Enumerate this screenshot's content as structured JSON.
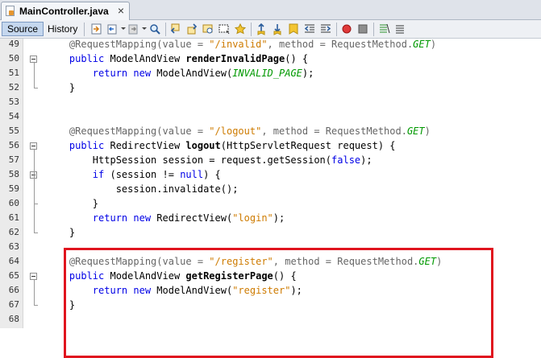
{
  "tab": {
    "title": "MainController.java",
    "close": "×"
  },
  "toolbar": {
    "source_label": "Source",
    "history_label": "History",
    "icons": [
      "last-edit-icon",
      "back-icon",
      "forward-icon",
      "find-icon",
      "find-previous-icon",
      "find-next-icon",
      "find-selection-icon",
      "toggle-highlight-icon",
      "toggle-rectangular-icon",
      "previous-bookmark-icon",
      "next-bookmark-icon",
      "toggle-bookmark-icon",
      "shift-left-icon",
      "shift-right-icon",
      "start-macro-icon",
      "stop-macro-icon",
      "comment-icon",
      "uncomment-icon"
    ]
  },
  "editor": {
    "lines": [
      {
        "n": "49",
        "fold": "",
        "t": [
          [
            "an",
            "    @RequestMapping(value = "
          ],
          [
            "str",
            "\"/invalid\""
          ],
          [
            "an",
            ", method = RequestMethod."
          ],
          [
            "cst",
            "GET"
          ],
          [
            "an",
            ")"
          ]
        ]
      },
      {
        "n": "50",
        "fold": "start",
        "t": [
          [
            "kw",
            "    public "
          ],
          [
            "",
            "ModelAndView "
          ],
          [
            "bold",
            "renderInvalidPage"
          ],
          [
            "",
            "() {"
          ]
        ]
      },
      {
        "n": "51",
        "fold": "",
        "t": [
          [
            "kw",
            "        return new "
          ],
          [
            "",
            "ModelAndView("
          ],
          [
            "cst",
            "INVALID_PAGE"
          ],
          [
            "",
            ");"
          ]
        ]
      },
      {
        "n": "52",
        "fold": "end",
        "t": [
          [
            "",
            "    }"
          ]
        ]
      },
      {
        "n": "53",
        "fold": "",
        "t": []
      },
      {
        "n": "54",
        "fold": "",
        "t": []
      },
      {
        "n": "55",
        "fold": "",
        "t": [
          [
            "an",
            "    @RequestMapping(value = "
          ],
          [
            "str",
            "\"/logout\""
          ],
          [
            "an",
            ", method = RequestMethod."
          ],
          [
            "cst",
            "GET"
          ],
          [
            "an",
            ")"
          ]
        ]
      },
      {
        "n": "56",
        "fold": "start",
        "t": [
          [
            "kw",
            "    public "
          ],
          [
            "",
            "RedirectView "
          ],
          [
            "bold",
            "logout"
          ],
          [
            "",
            "(HttpServletRequest request) {"
          ]
        ]
      },
      {
        "n": "57",
        "fold": "",
        "t": [
          [
            "",
            "        HttpSession session = request.getSession("
          ],
          [
            "kw",
            "false"
          ],
          [
            "",
            ");"
          ]
        ]
      },
      {
        "n": "58",
        "fold": "start",
        "t": [
          [
            "kw",
            "        if "
          ],
          [
            "",
            "(session != "
          ],
          [
            "kw",
            "null"
          ],
          [
            "",
            ") {"
          ]
        ]
      },
      {
        "n": "59",
        "fold": "",
        "t": [
          [
            "",
            "            session.invalidate();"
          ]
        ]
      },
      {
        "n": "60",
        "fold": "end",
        "t": [
          [
            "",
            "        }"
          ]
        ]
      },
      {
        "n": "61",
        "fold": "",
        "t": [
          [
            "kw",
            "        return new "
          ],
          [
            "",
            "RedirectView("
          ],
          [
            "str",
            "\"login\""
          ],
          [
            "",
            ");"
          ]
        ]
      },
      {
        "n": "62",
        "fold": "end",
        "t": [
          [
            "",
            "    }"
          ]
        ]
      },
      {
        "n": "63",
        "fold": "",
        "t": []
      },
      {
        "n": "64",
        "fold": "",
        "t": [
          [
            "an",
            "    @RequestMapping(value = "
          ],
          [
            "str",
            "\"/register\""
          ],
          [
            "an",
            ", method = RequestMethod."
          ],
          [
            "cst",
            "GET"
          ],
          [
            "an",
            ")"
          ]
        ]
      },
      {
        "n": "65",
        "fold": "start",
        "t": [
          [
            "kw",
            "    public "
          ],
          [
            "",
            "ModelAndView "
          ],
          [
            "bold",
            "getRegisterPage"
          ],
          [
            "",
            "() {"
          ]
        ]
      },
      {
        "n": "66",
        "fold": "",
        "t": [
          [
            "kw",
            "        return new "
          ],
          [
            "",
            "ModelAndView("
          ],
          [
            "str",
            "\"register\""
          ],
          [
            "",
            ");"
          ]
        ]
      },
      {
        "n": "67",
        "fold": "end",
        "t": [
          [
            "",
            "    }"
          ]
        ]
      },
      {
        "n": "68",
        "fold": "",
        "t": []
      }
    ]
  },
  "colors": {
    "keyword": "#0000e6",
    "string": "#ce7b00",
    "constant": "#009900",
    "highlight_box": "#e0141e"
  }
}
